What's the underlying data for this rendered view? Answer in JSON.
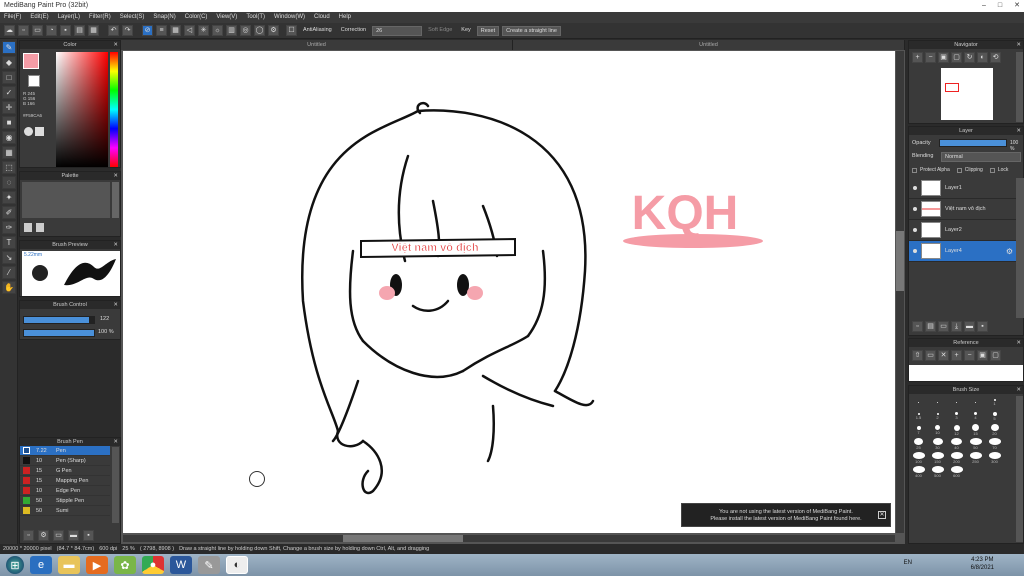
{
  "window": {
    "title": "MediBang Paint Pro (32bit)",
    "controls": [
      "–",
      "□",
      "✕"
    ]
  },
  "menu": [
    "File(F)",
    "Edit(E)",
    "Layer(L)",
    "Filter(R)",
    "Select(S)",
    "Snap(N)",
    "Color(C)",
    "View(V)",
    "Tool(T)",
    "Window(W)",
    "Cloud",
    "Help"
  ],
  "toolbar": {
    "antialiasing": "AntiAliasing",
    "correction_label": "Correction",
    "correction_value": "26",
    "soft_edge": "Soft Edge",
    "key": "Key",
    "reset": "Reset",
    "straight_line": "Create a straight line"
  },
  "tabs": [
    "Untitled",
    "Untitled"
  ],
  "color_panel": {
    "title": "Color",
    "r": "R 245",
    "g": "G 156",
    "b": "B 166",
    "hex": "#F59CA6",
    "fg": "#f59ca6"
  },
  "palette_panel": {
    "title": "Palette"
  },
  "brush_preview": {
    "title": "Brush Preview",
    "size": "5.22mm"
  },
  "brush_control": {
    "title": "Brush Control",
    "size_value": "122",
    "opacity_value": "100 %",
    "size_level": 0.93,
    "opacity_level": 1.0
  },
  "brush_panel": {
    "title": "Brush Pen",
    "items": [
      {
        "size": "7.22",
        "name": "Pen",
        "color": "#1c4f8f"
      },
      {
        "size": "10",
        "name": "Pen (Sharp)",
        "color": "#111111"
      },
      {
        "size": "15",
        "name": "G Pen",
        "color": "#cc2222"
      },
      {
        "size": "15",
        "name": "Mapping Pen",
        "color": "#cc2222"
      },
      {
        "size": "10",
        "name": "Edge Pen",
        "color": "#cc2222"
      },
      {
        "size": "50",
        "name": "Stipple Pen",
        "color": "#33aa33"
      },
      {
        "size": "50",
        "name": "Sumi",
        "color": "#ddbb22"
      }
    ]
  },
  "navigator": {
    "title": "Navigator"
  },
  "layer_panel": {
    "title": "Layer",
    "opacity_label": "Opacity",
    "opacity_value": "100 %",
    "opacity_level": 1.0,
    "blending_label": "Blending",
    "blending_value": "Normal",
    "protect_alpha": "Protect Alpha",
    "clipping": "Clipping",
    "lock": "Lock",
    "layers": [
      "Layer1",
      "Việt nam vô địch",
      "Layer2",
      "Layer4"
    ]
  },
  "reference_panel": {
    "title": "Reference"
  },
  "brush_size_panel": {
    "title": "Brush Size",
    "sizes": [
      "",
      "",
      "",
      "",
      "1",
      "1.5",
      "2",
      "3",
      "4",
      "5",
      "7",
      "10",
      "12",
      "15",
      "20",
      "25",
      "30",
      "40",
      "50",
      "70",
      "100",
      "150",
      "200",
      "250",
      "300",
      "400",
      "500",
      "600"
    ]
  },
  "canvas": {
    "headband_text": "Việt nam vô địch",
    "sign_text": "KQH"
  },
  "notice": {
    "line1": "You are not using the latest version of MediBang Paint.",
    "line2": "Please install the latest version of MediBang Paint found here."
  },
  "status": {
    "size": "20000 * 20000 pixel",
    "physical": "(84.7 * 84.7cm)",
    "dpi": "600 dpi",
    "zoom": "25 %",
    "coords": "( 2798, 8908 )",
    "hint": "Draw a straight line by holding down Shift, Change a brush size by holding down Ctrl, Alt, and dragging"
  },
  "taskbar": {
    "lang": "EN",
    "time": "4:23 PM",
    "date": "6/8/2021"
  }
}
